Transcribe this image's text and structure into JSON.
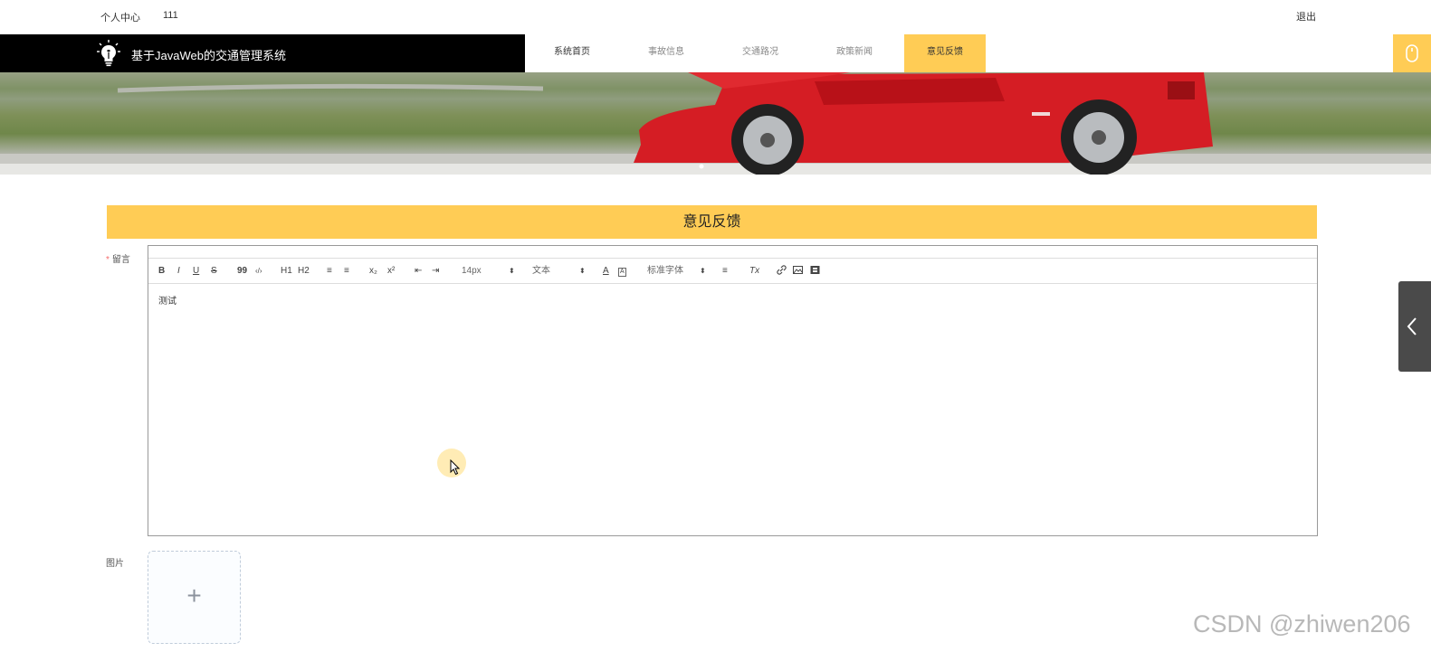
{
  "topbar": {
    "user_center": "个人中心",
    "username": "111",
    "logout": "退出"
  },
  "header": {
    "title": "基于JavaWeb的交通管理系统",
    "nav": [
      {
        "label": "系统首页"
      },
      {
        "label": "事故信息"
      },
      {
        "label": "交通路况"
      },
      {
        "label": "政策新闻"
      },
      {
        "label": "意见反馈",
        "active": true
      }
    ]
  },
  "section": {
    "title": "意见反馈"
  },
  "form": {
    "message_label": "留言",
    "message_required_mark": "*",
    "image_label": "图片",
    "editor": {
      "content": "测试",
      "toolbar": {
        "bold": "B",
        "italic": "I",
        "underline": "U",
        "strike": "S",
        "quote": "99",
        "code": "‹/›",
        "h1": "H1",
        "h2": "H2",
        "ordered_list": "≡",
        "bullet_list": "≡",
        "subscript": "x₂",
        "superscript": "x²",
        "outdent": "⇤",
        "indent": "⇥",
        "size_select": "14px",
        "header_select": "文本",
        "font_select": "标准字体",
        "align": "≡",
        "clean": "Tx"
      }
    },
    "upload_icon": "plus-icon"
  },
  "colors": {
    "accent": "#ffcc55",
    "accent_dark": "#d19a10",
    "header_bg": "#000000",
    "required": "#f56c6c"
  },
  "watermark": "CSDN @zhiwen206"
}
